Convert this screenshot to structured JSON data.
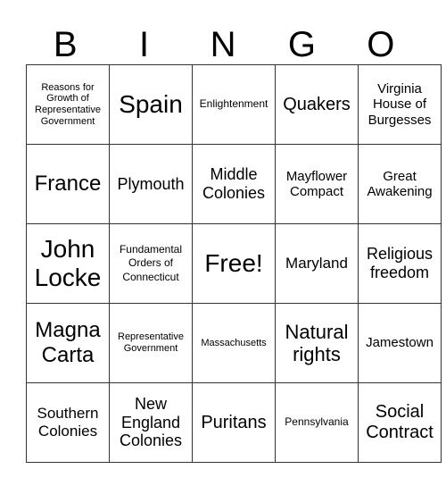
{
  "header": [
    "B",
    "I",
    "N",
    "G",
    "O"
  ],
  "rows": [
    [
      "Reasons for Growth of Representative Government",
      "Spain",
      "Enlightenment",
      "Quakers",
      "Virginia House of Burgesses"
    ],
    [
      "France",
      "Plymouth",
      "Middle Colonies",
      "Mayflower Compact",
      "Great Awakening"
    ],
    [
      "John Locke",
      "Fundamental Orders of Connecticut",
      "Free!",
      "Maryland",
      "Religious freedom"
    ],
    [
      "Magna Carta",
      "Representative Government",
      "Massachusetts",
      "Natural rights",
      "Jamestown"
    ],
    [
      "Southern Colonies",
      "New England Colonies",
      "Puritans",
      "Pennsylvania",
      "Social Contract"
    ]
  ]
}
